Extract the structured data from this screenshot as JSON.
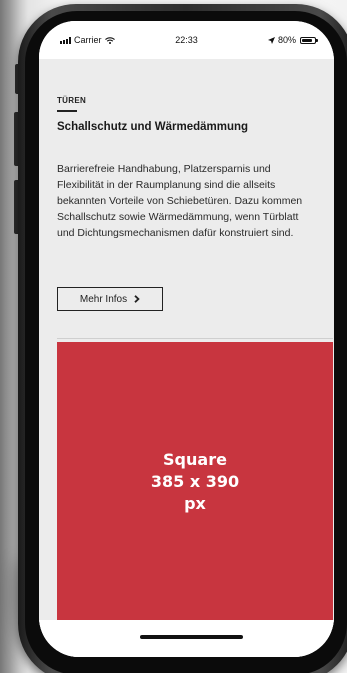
{
  "status_bar": {
    "carrier": "Carrier",
    "time": "22:33",
    "battery": "80%",
    "battery_level": 0.8,
    "icons": [
      "signal-icon",
      "wifi-icon",
      "location-icon",
      "battery-icon"
    ]
  },
  "article": {
    "category": "TÜREN",
    "headline": "Schallschutz und Wärmedämmung",
    "body": "Barrierefreie Handhabung, Platzersparnis und Flexibilität in der Raumplanung sind die allseits bekannten Vorteile von Schiebetüren. Dazu kommen Schallschutz sowie Wärmedämmung, wenn Türblatt und Dichtungsmechanismen dafür konstruiert sind.",
    "button_label": "Mehr Infos",
    "button_icon": "chevron-right-icon"
  },
  "image_placeholder": {
    "line1": "Square",
    "line2": "385 x 390",
    "line3": "px",
    "color": "#c8353f"
  },
  "colors": {
    "placeholder_red": "#c8353f",
    "content_background": "#ececec",
    "text": "#1a1a1a"
  }
}
